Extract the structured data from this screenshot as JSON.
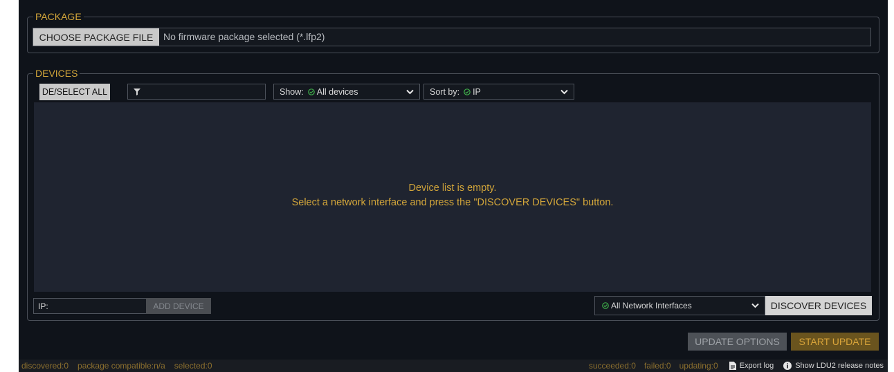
{
  "package": {
    "legend": "PACKAGE",
    "choose_button": "CHOOSE PACKAGE FILE",
    "file_status": "No firmware package selected (*.lfp2)"
  },
  "devices": {
    "legend": "DEVICES",
    "deselect_button": "DE/SELECT ALL",
    "filter_value": "",
    "show_label": "Show:",
    "show_value": "All devices",
    "sort_label": "Sort by:",
    "sort_value": "IP",
    "empty_line1": "Device list is empty.",
    "empty_line2": "Select a network interface and press the \"DISCOVER DEVICES\" button.",
    "ip_label": "IP:",
    "add_device_button": "ADD DEVICE",
    "interface_value": "All Network Interfaces",
    "discover_button": "DISCOVER DEVICES"
  },
  "actions": {
    "update_options": "UPDATE OPTIONS",
    "start_update": "START UPDATE"
  },
  "status": {
    "discovered": "discovered:0",
    "compatible": "package compatible:n/a",
    "selected": "selected:0",
    "succeeded": "succeeded:0",
    "failed": "failed:0",
    "updating": "updating:0",
    "export_log": "Export log",
    "release_notes": "Show LDU2 release notes"
  },
  "icons": {
    "filter": "filter-icon",
    "check": "check-circle-icon",
    "chevron": "chevron-down-icon",
    "document": "document-icon",
    "info": "info-icon"
  },
  "colors": {
    "background": "#0f131a",
    "accent": "#d3a63a",
    "list_area": "#1f2430",
    "check": "#3fae4a"
  }
}
